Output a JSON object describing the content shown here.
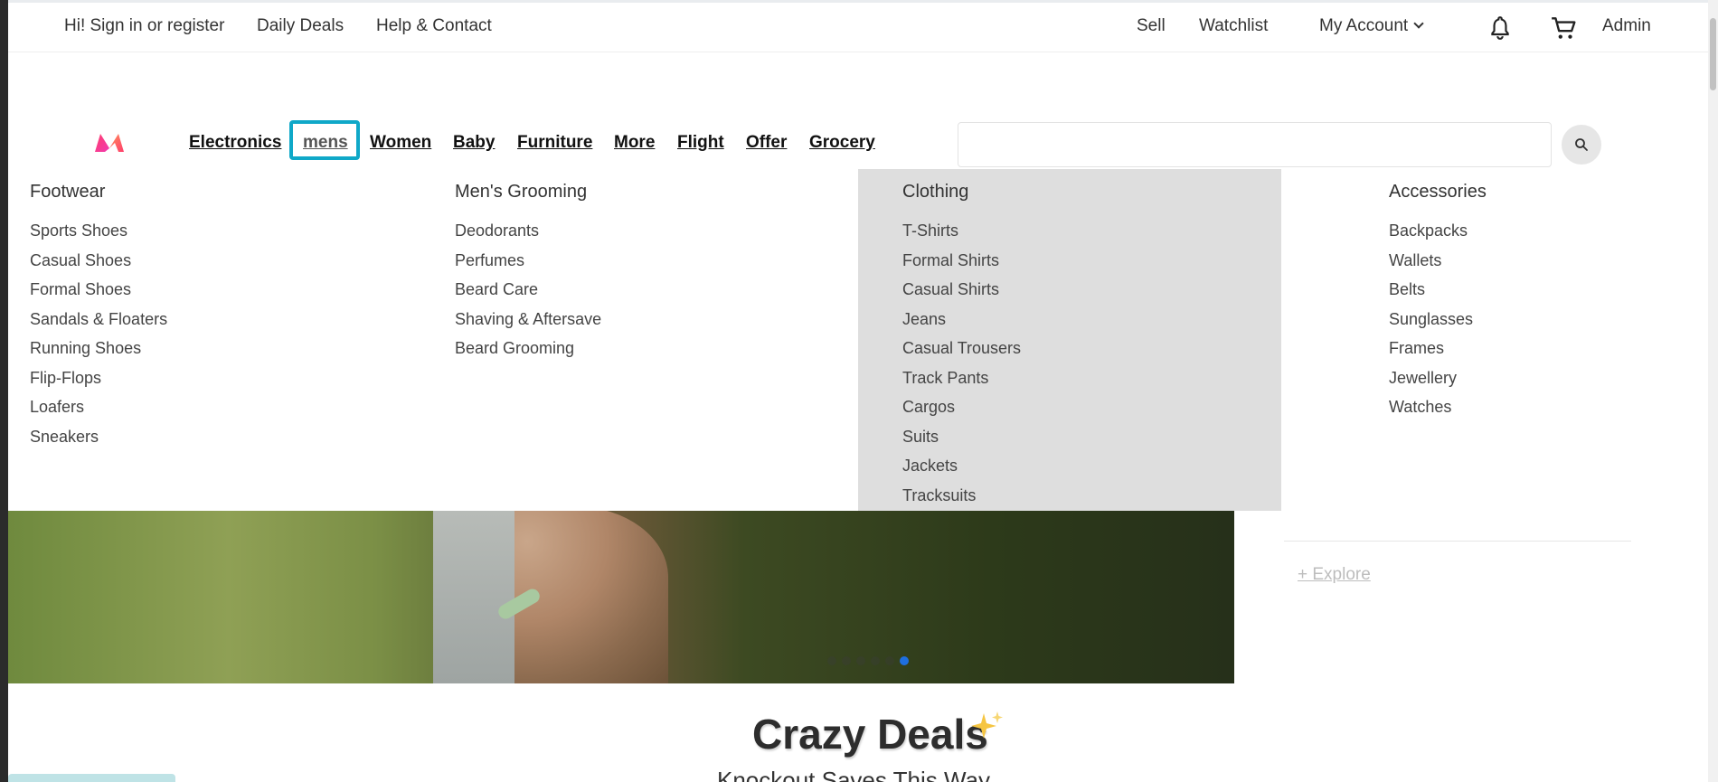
{
  "topbar": {
    "signin": "Hi! Sign in or register",
    "daily_deals": "Daily Deals",
    "help": "Help & Contact",
    "sell": "Sell",
    "watchlist": "Watchlist",
    "my_account": "My Account",
    "admin": "Admin",
    "icons": [
      "bell-icon",
      "cart-icon",
      "chevron-down-icon"
    ]
  },
  "nav": {
    "items": [
      "Electronics",
      "mens",
      "Women",
      "Baby",
      "Furniture",
      "More",
      "Flight",
      "Offer",
      "Grocery"
    ],
    "active": "mens"
  },
  "search": {
    "placeholder": "",
    "value": ""
  },
  "mega_menu": {
    "footwear": {
      "title": "Footwear",
      "items": [
        "Sports Shoes",
        "Casual Shoes",
        "Formal Shoes",
        "Sandals & Floaters",
        "Running Shoes",
        "Flip-Flops",
        "Loafers",
        "Sneakers"
      ]
    },
    "grooming": {
      "title": "Men's Grooming",
      "items": [
        "Deodorants",
        "Perfumes",
        "Beard Care",
        "Shaving & Aftersave",
        "Beard Grooming"
      ]
    },
    "clothing": {
      "title": "Clothing",
      "items": [
        "T-Shirts",
        "Formal Shirts",
        "Casual Shirts",
        "Jeans",
        "Casual Trousers",
        "Track Pants",
        "Cargos",
        "Suits",
        "Jackets",
        "Tracksuits"
      ]
    },
    "accessories": {
      "title": "Accessories",
      "items": [
        "Backpacks",
        "Wallets",
        "Belts",
        "Sunglasses",
        "Frames",
        "Jewellery",
        "Watches"
      ]
    }
  },
  "side": {
    "explore": "+ Explore"
  },
  "deals": {
    "title": "Crazy Deals",
    "subtitle": "Knockout Saves This Way"
  },
  "colors": {
    "focus": "#0fa8c8",
    "active_dot": "#1e6fe0",
    "clothing_bg": "#dedede"
  }
}
